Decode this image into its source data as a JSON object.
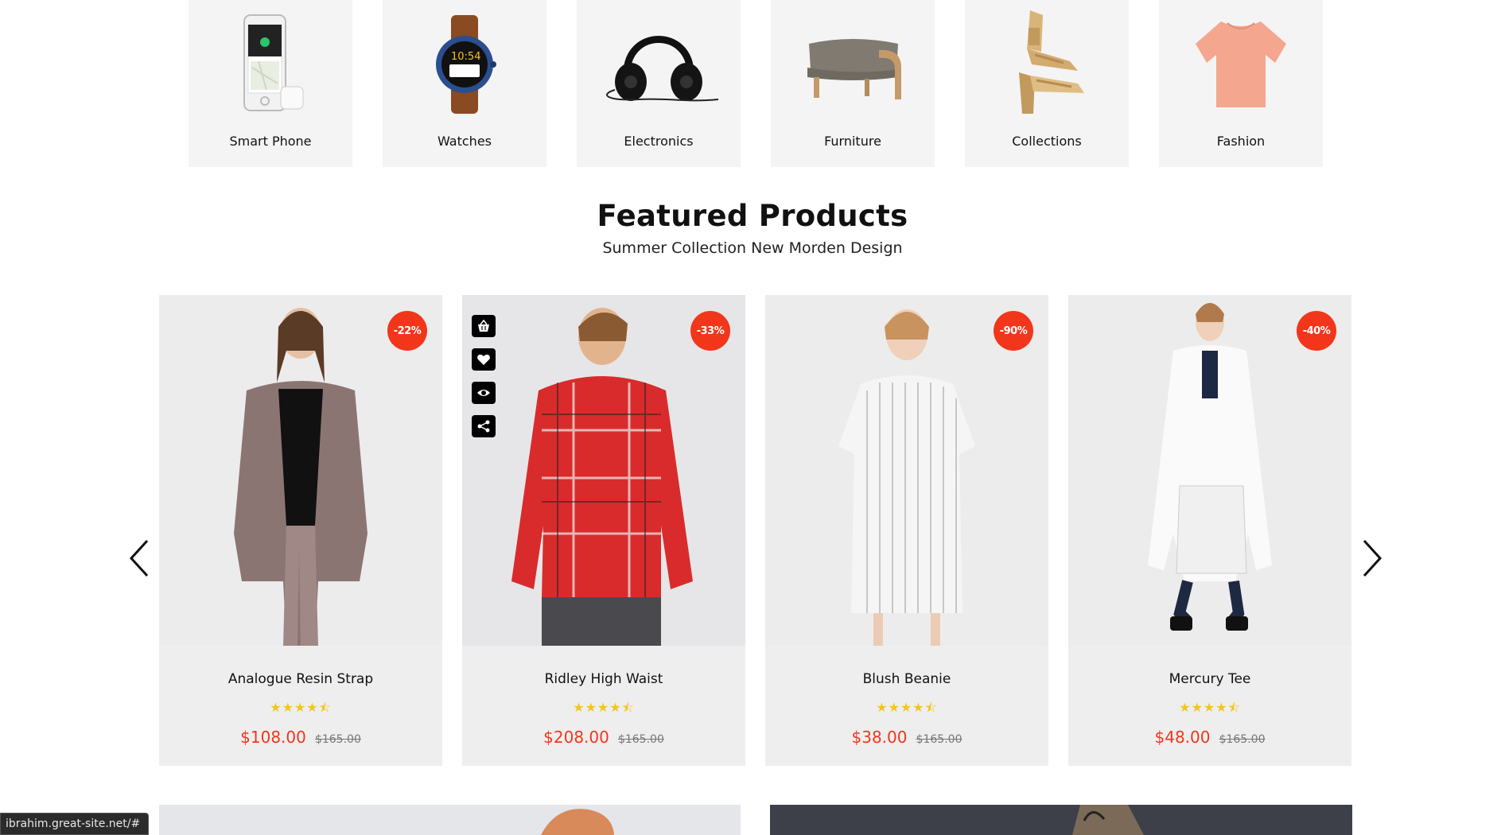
{
  "categories": [
    {
      "label": "Smart Phone",
      "icon": "smartphone-image"
    },
    {
      "label": "Watches",
      "icon": "watch-image"
    },
    {
      "label": "Electronics",
      "icon": "headphones-image"
    },
    {
      "label": "Furniture",
      "icon": "ottoman-image"
    },
    {
      "label": "Collections",
      "icon": "sandals-image"
    },
    {
      "label": "Fashion",
      "icon": "tshirt-image"
    }
  ],
  "featured": {
    "title": "Featured Products",
    "subtitle": "Summer Collection New Morden Design"
  },
  "products": [
    {
      "name": "Analogue Resin Strap",
      "badge": "-22%",
      "price": "$108.00",
      "old_price": "$165.00",
      "rating": 4.5,
      "stars": "★★★★⯪"
    },
    {
      "name": "Ridley High Waist",
      "badge": "-33%",
      "price": "$208.00",
      "old_price": "$165.00",
      "rating": 4.5,
      "stars": "★★★★⯪"
    },
    {
      "name": "Blush Beanie",
      "badge": "-90%",
      "price": "$38.00",
      "old_price": "$165.00",
      "rating": 4.5,
      "stars": "★★★★⯪"
    },
    {
      "name": "Mercury Tee",
      "badge": "-40%",
      "price": "$48.00",
      "old_price": "$165.00",
      "rating": 4.5,
      "stars": "★★★★⯪"
    }
  ],
  "hover_actions": [
    "basket-icon",
    "heart-icon",
    "eye-icon",
    "share-icon"
  ],
  "status_url": "ibrahim.great-site.net/#",
  "colors": {
    "accent": "#f2361c",
    "star": "#f5c518",
    "card_bg": "#eeeeee"
  }
}
